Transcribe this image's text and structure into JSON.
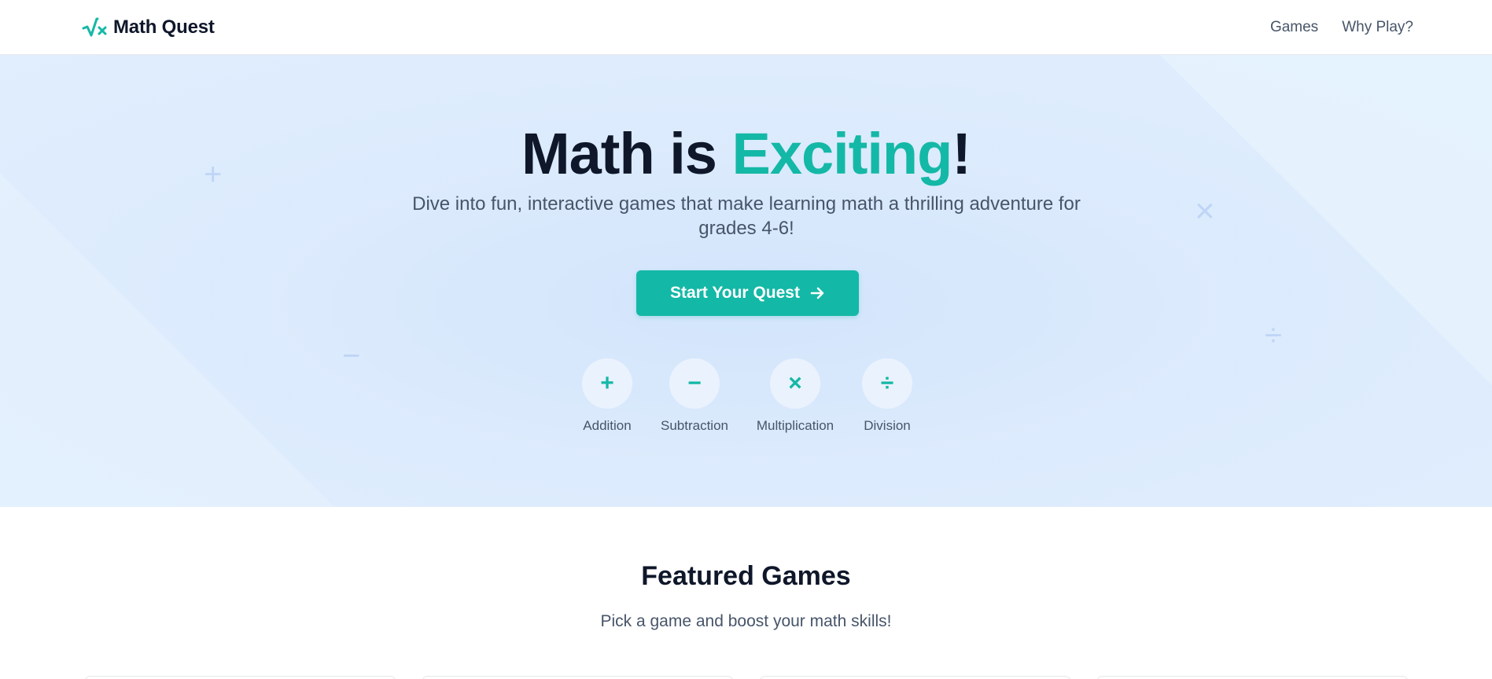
{
  "header": {
    "brand_name": "Math Quest",
    "logo_icon": "sqrt-x-icon",
    "nav": [
      {
        "label": "Games"
      },
      {
        "label": "Why Play?"
      }
    ]
  },
  "hero": {
    "title_prefix": "Math is ",
    "title_accent": "Exciting",
    "title_suffix": "!",
    "subtitle": "Dive into fun, interactive games that make learning math a thrilling adventure for grades 4-6!",
    "cta_label": "Start Your Quest",
    "cta_icon": "arrow-right-icon",
    "operations": [
      {
        "symbol": "+",
        "label": "Addition",
        "icon": "plus-icon"
      },
      {
        "symbol": "−",
        "label": "Subtraction",
        "icon": "minus-icon"
      },
      {
        "symbol": "×",
        "label": "Multiplication",
        "icon": "times-icon"
      },
      {
        "symbol": "÷",
        "label": "Division",
        "icon": "divide-icon"
      }
    ],
    "decorative_symbols": [
      "+",
      "−",
      "×",
      "÷"
    ]
  },
  "featured": {
    "title": "Featured Games",
    "subtitle": "Pick a game and boost your math skills!"
  },
  "colors": {
    "accent": "#14b8a6",
    "text_dark": "#0f172a",
    "text_muted": "#475569",
    "hero_bg": "#dbeafe"
  }
}
